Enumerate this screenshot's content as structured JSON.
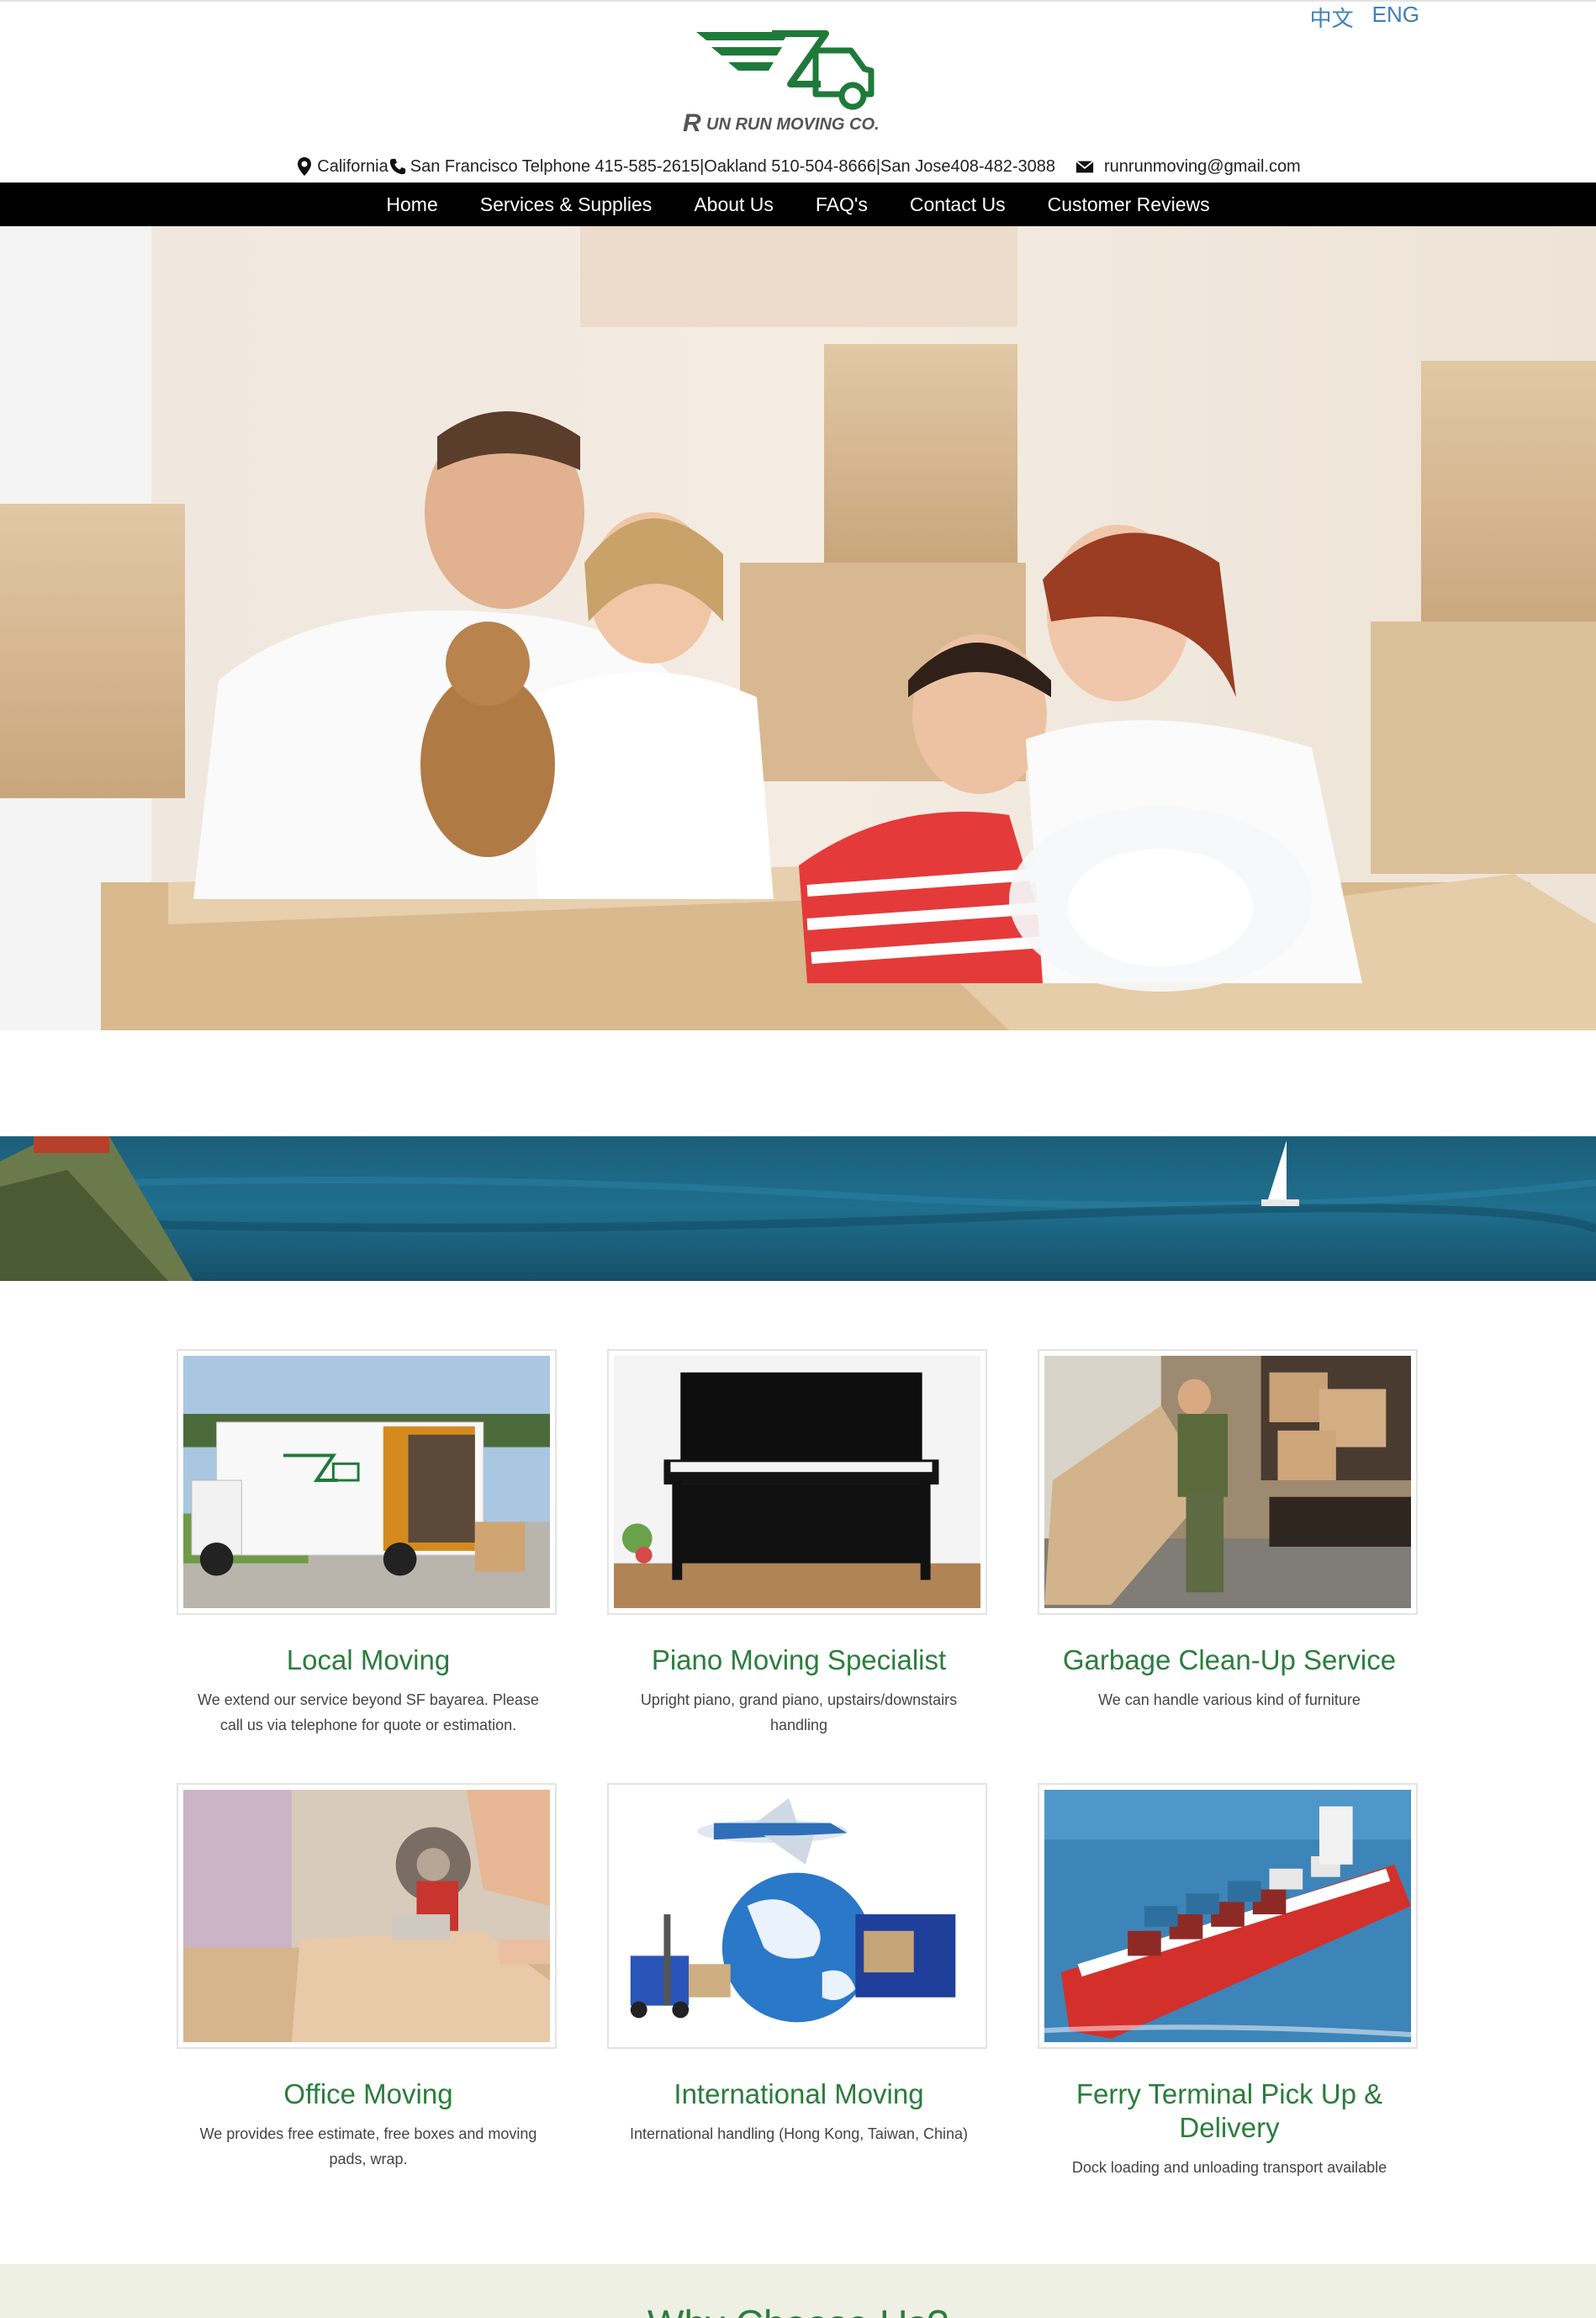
{
  "lang": {
    "zh": "中文",
    "en": "ENG"
  },
  "brand": {
    "name": "RUN RUN MOVING CO.",
    "color": "#1f7a3a"
  },
  "contact": {
    "location": "California",
    "phones": "San Francisco Telphone 415-585-2615|Oakland 510-504-8666|San Jose408-482-3088",
    "email": "runrunmoving@gmail.com"
  },
  "nav": {
    "items": [
      "Home",
      "Services & Supplies",
      "About Us",
      "FAQ's",
      "Contact Us",
      "Customer Reviews"
    ]
  },
  "services": [
    {
      "title": "Local Moving",
      "description": "We extend our service beyond SF bayarea. Please call us via telephone for quote or estimation.",
      "image_icon": "moving-truck"
    },
    {
      "title": "Piano Moving Specialist",
      "description": "Upright piano, grand piano, upstairs/downstairs handling",
      "image_icon": "piano"
    },
    {
      "title": "Garbage Clean-Up Service",
      "description": "We can handle various kind of furniture",
      "image_icon": "mover-boxes"
    },
    {
      "title": "Office Moving",
      "description": "We provides free estimate, free boxes and moving pads, wrap.",
      "image_icon": "tape-dispenser"
    },
    {
      "title": "International Moving",
      "description": "International handling (Hong Kong, Taiwan, China)",
      "image_icon": "globe-plane"
    },
    {
      "title": "Ferry Terminal Pick Up & Delivery",
      "description": "Dock loading and unloading transport available",
      "image_icon": "cargo-ship"
    }
  ],
  "bottom": {
    "heading": "Why Choose Us?"
  }
}
